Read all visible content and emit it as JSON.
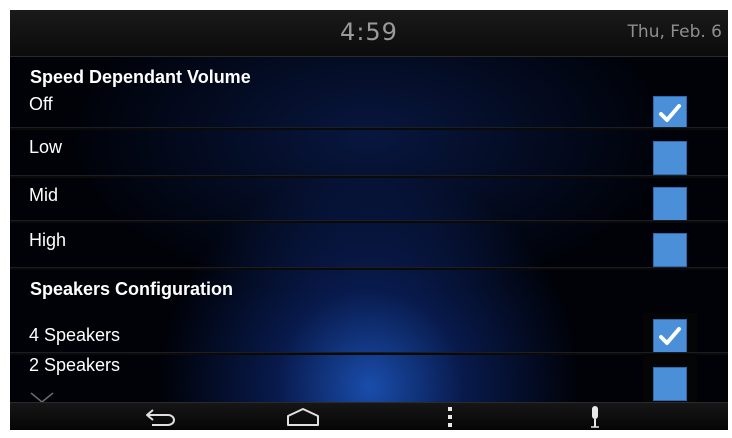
{
  "status_bar": {
    "time": "4:59",
    "date": "Thu, Feb. 6"
  },
  "speed_volume": {
    "header": "Speed Dependant Volume",
    "options": [
      {
        "label": "Off",
        "checked": true
      },
      {
        "label": "Low",
        "checked": false
      },
      {
        "label": "Mid",
        "checked": false
      },
      {
        "label": "High",
        "checked": false
      }
    ]
  },
  "speakers": {
    "header": "Speakers Configuration",
    "options": [
      {
        "label": "4 Speakers",
        "checked": true
      },
      {
        "label": "2 Speakers",
        "checked": false
      }
    ]
  },
  "nav": {
    "icons": [
      "back-icon",
      "home-icon",
      "menu-icon",
      "microphone-icon"
    ]
  },
  "colors": {
    "checkbox": "#4a8fd8",
    "accent_glow": "#1e5ac8",
    "text": "#ffffff"
  }
}
